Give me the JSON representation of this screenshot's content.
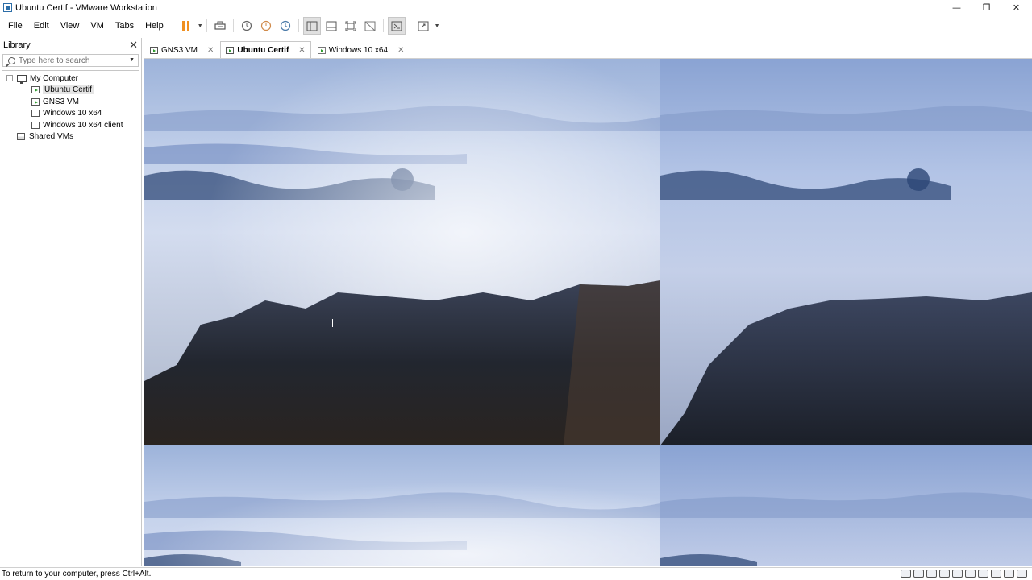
{
  "window": {
    "title": "Ubuntu Certif - VMware Workstation",
    "controls": [
      "minimize",
      "restore",
      "close"
    ]
  },
  "menu": [
    "File",
    "Edit",
    "View",
    "VM",
    "Tabs",
    "Help"
  ],
  "toolbar": {
    "icons": [
      "pause-icon",
      "send-ctrl-alt-del-icon",
      "snapshot-icon",
      "revert-snapshot-icon",
      "snapshot-manager-icon",
      "show-library-icon",
      "thumbnail-bar-icon",
      "full-screen-icon",
      "unity-icon",
      "console-view-icon",
      "stretch-guest-icon"
    ]
  },
  "library": {
    "title": "Library",
    "search_placeholder": "Type here to search",
    "tree": [
      {
        "label": "My Computer",
        "level": 0,
        "icon": "computer-icon",
        "expanded": true
      },
      {
        "label": "Ubuntu Certif",
        "level": 1,
        "icon": "vm-running-icon",
        "selected": true
      },
      {
        "label": "GNS3 VM",
        "level": 1,
        "icon": "vm-running-icon"
      },
      {
        "label": "Windows 10 x64",
        "level": 1,
        "icon": "vm-icon"
      },
      {
        "label": "Windows 10 x64 client",
        "level": 1,
        "icon": "vm-icon"
      },
      {
        "label": "Shared VMs",
        "level": 0,
        "icon": "shared-vms-icon"
      }
    ]
  },
  "tabs": [
    {
      "label": "GNS3 VM",
      "active": false
    },
    {
      "label": "Ubuntu Certif",
      "active": true
    },
    {
      "label": "Windows 10 x64",
      "active": false
    }
  ],
  "status": {
    "message": "To return to your computer, press Ctrl+Alt.",
    "device_icons": [
      "hard-disk-icon",
      "hard-disk-icon",
      "hard-disk-icon",
      "cd-dvd-icon",
      "network-icon",
      "usb-icon",
      "sound-icon",
      "printer-icon",
      "display-icon",
      "message-icon"
    ]
  },
  "colors": {
    "pause_accent": "#f09020",
    "running_accent": "#2a9a2a"
  }
}
